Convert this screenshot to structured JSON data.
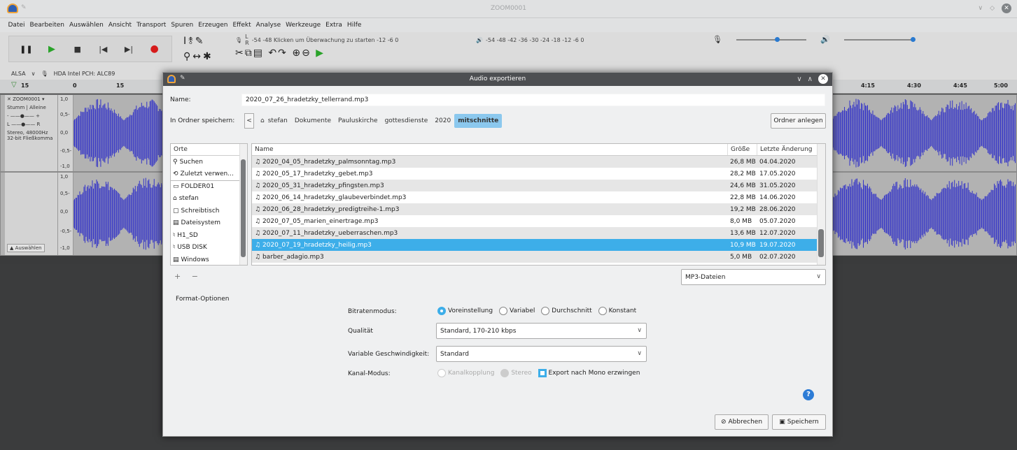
{
  "window": {
    "title": "ZOOM0001"
  },
  "menu": [
    "Datei",
    "Bearbeiten",
    "Auswählen",
    "Ansicht",
    "Transport",
    "Spuren",
    "Erzeugen",
    "Effekt",
    "Analyse",
    "Werkzeuge",
    "Extra",
    "Hilfe"
  ],
  "meters": {
    "rec_scale": "-54   -48  Klicken um Überwachung zu starten  -12     -6     0",
    "play_scale": "-54    -48    -42    -36    -30    -24    -18    -12    -6    0",
    "rec_label_l": "L",
    "rec_label_r": "R"
  },
  "device": {
    "host": "ALSA",
    "input": "HDA Intel PCH: ALC89"
  },
  "ruler": {
    "left_value": "15",
    "ticks_left": [
      "0",
      "15"
    ],
    "ticks_right": [
      "4:15",
      "4:30",
      "4:45",
      "5:00"
    ]
  },
  "track": {
    "name": "ZOOM0001",
    "mute": "Stumm",
    "solo": "Alleine",
    "pan_l": "L",
    "pan_r": "R",
    "info": "Stereo, 48000Hz",
    "format": "32-bit Fließkomma",
    "select": "Auswählen",
    "scale": [
      "1,0",
      "0,5-",
      "0,0",
      "-0,5-",
      "-1,0"
    ]
  },
  "dialog": {
    "title": "Audio exportieren",
    "name_label": "Name:",
    "name_value": "2020_07_26_hradetzky_tellerrand.mp3",
    "folder_label": "In Ordner speichern:",
    "breadcrumb": [
      "stefan",
      "Dokumente",
      "Pauluskirche",
      "gottesdienste",
      "2020",
      "mitschnitte"
    ],
    "new_folder": "Ordner anlegen",
    "places_header": "Orte",
    "places": [
      {
        "icon": "search-icon",
        "glyph": "⚲",
        "label": "Suchen"
      },
      {
        "icon": "recent-icon",
        "glyph": "⟲",
        "label": "Zuletzt verwen..."
      },
      {
        "icon": "folder-icon",
        "glyph": "▭",
        "label": "FOLDER01"
      },
      {
        "icon": "home-icon",
        "glyph": "⌂",
        "label": "stefan"
      },
      {
        "icon": "desktop-icon",
        "glyph": "▢",
        "label": "Schreibtisch"
      },
      {
        "icon": "drive-icon",
        "glyph": "▤",
        "label": "Dateisystem"
      },
      {
        "icon": "usb-icon",
        "glyph": "♮",
        "label": "H1_SD"
      },
      {
        "icon": "usb-icon",
        "glyph": "♮",
        "label": "USB DISK"
      },
      {
        "icon": "drive-icon",
        "glyph": "▤",
        "label": "Windows"
      }
    ],
    "columns": {
      "name": "Name",
      "size": "Größe",
      "modified": "Letzte Änderung"
    },
    "files": [
      {
        "name": "2020_04_05_hradetzky_palmsonntag.mp3",
        "size": "26,8 MB",
        "date": "04.04.2020"
      },
      {
        "name": "2020_05_17_hradetzky_gebet.mp3",
        "size": "28,2 MB",
        "date": "17.05.2020"
      },
      {
        "name": "2020_05_31_hradetzky_pfingsten.mp3",
        "size": "24,6 MB",
        "date": "31.05.2020"
      },
      {
        "name": "2020_06_14_hradetzky_glaubeverbindet.mp3",
        "size": "22,8 MB",
        "date": "14.06.2020"
      },
      {
        "name": "2020_06_28_hradetzky_predigtreihe-1.mp3",
        "size": "19,2 MB",
        "date": "28.06.2020"
      },
      {
        "name": "2020_07_05_marien_einertrage.mp3",
        "size": "8,0 MB",
        "date": "05.07.2020"
      },
      {
        "name": "2020_07_11_hradetzky_ueberraschen.mp3",
        "size": "13,6 MB",
        "date": "12.07.2020"
      },
      {
        "name": "2020_07_19_hradetzky_heilig.mp3",
        "size": "10,9 MB",
        "date": "19.07.2020"
      },
      {
        "name": "barber_adagio.mp3",
        "size": "5,0 MB",
        "date": "02.07.2020"
      }
    ],
    "selected_file_index": 7,
    "filter": "MP3-Dateien",
    "format_options": "Format-Optionen",
    "bitrate_label": "Bitratenmodus:",
    "bitrate_options": [
      "Voreinstellung",
      "Variabel",
      "Durchschnitt",
      "Konstant"
    ],
    "bitrate_selected": "Voreinstellung",
    "quality_label": "Qualität",
    "quality_value": "Standard, 170-210 kbps",
    "speed_label": "Variable Geschwindigkeit:",
    "speed_value": "Standard",
    "channel_label": "Kanal-Modus:",
    "channel_options": [
      "Kanalkopplung",
      "Stereo"
    ],
    "mono_label": "Export nach Mono erzwingen",
    "cancel": "Abbrechen",
    "save": "Speichern"
  },
  "colors": {
    "accent": "#3daee9",
    "selected_crumb": "#8bc8ee",
    "waveform": "#3232c8",
    "dialog_title": "#4d4f52"
  }
}
